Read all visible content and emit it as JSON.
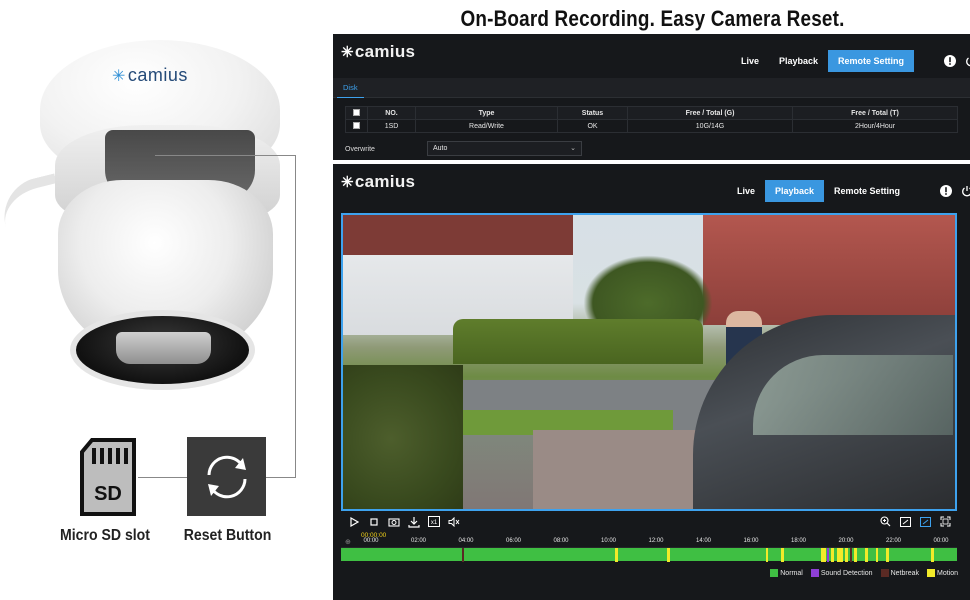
{
  "headline": "On-Board Recording. Easy Camera Reset.",
  "camera": {
    "logo": "camius"
  },
  "left_labels": {
    "sd_slot": "Micro SD slot",
    "reset": "Reset Button",
    "sd_card_text": "SD"
  },
  "top_panel": {
    "brand": "camius",
    "nav": [
      "Live",
      "Playback",
      "Remote Setting"
    ],
    "active_nav": "Remote Setting",
    "subtab": "Disk",
    "table": {
      "headers": [
        "",
        "NO.",
        "Type",
        "Status",
        "Free / Total (G)",
        "Free / Total (T)"
      ],
      "rows": [
        [
          "",
          "1SD",
          "Read/Write",
          "OK",
          "10G/14G",
          "2Hour/4Hour"
        ]
      ]
    },
    "overwrite_label": "Overwrite",
    "overwrite_value": "Auto"
  },
  "bottom_panel": {
    "brand": "camius",
    "nav": [
      "Live",
      "Playback",
      "Remote Setting"
    ],
    "active_nav": "Playback",
    "current_time": "00:00:00",
    "timeline_ticks": [
      "00:00",
      "02:00",
      "04:00",
      "06:00",
      "08:00",
      "10:00",
      "12:00",
      "14:00",
      "16:00",
      "18:00",
      "20:00",
      "22:00",
      "00:00"
    ],
    "legend": [
      {
        "label": "Normal",
        "color": "#3fbf43"
      },
      {
        "label": "Sound Detection",
        "color": "#8e3fd6"
      },
      {
        "label": "Netbreak",
        "color": "#5a2a24"
      },
      {
        "label": "Motion",
        "color": "#f2ea2a"
      }
    ],
    "recording_segments": [
      {
        "type": "Netbreak",
        "start": 0.196,
        "end": 0.2
      },
      {
        "type": "Motion",
        "start": 0.445,
        "end": 0.449
      },
      {
        "type": "Motion",
        "start": 0.53,
        "end": 0.534
      },
      {
        "type": "Motion",
        "start": 0.69,
        "end": 0.694
      },
      {
        "type": "Motion",
        "start": 0.715,
        "end": 0.719
      },
      {
        "type": "Motion",
        "start": 0.78,
        "end": 0.788
      },
      {
        "type": "Sound Detection",
        "start": 0.789,
        "end": 0.793
      },
      {
        "type": "Motion",
        "start": 0.796,
        "end": 0.8
      },
      {
        "type": "Motion",
        "start": 0.805,
        "end": 0.815
      },
      {
        "type": "Motion",
        "start": 0.818,
        "end": 0.823
      },
      {
        "type": "Netbreak",
        "start": 0.826,
        "end": 0.829
      },
      {
        "type": "Motion",
        "start": 0.832,
        "end": 0.838
      },
      {
        "type": "Motion",
        "start": 0.85,
        "end": 0.856
      },
      {
        "type": "Motion",
        "start": 0.868,
        "end": 0.872
      },
      {
        "type": "Motion",
        "start": 0.885,
        "end": 0.89
      },
      {
        "type": "Motion",
        "start": 0.958,
        "end": 0.963
      }
    ]
  },
  "colors": {
    "accent": "#3ea2ee",
    "panel_bg": "#16181b",
    "timeline_green": "#3fbf43"
  }
}
